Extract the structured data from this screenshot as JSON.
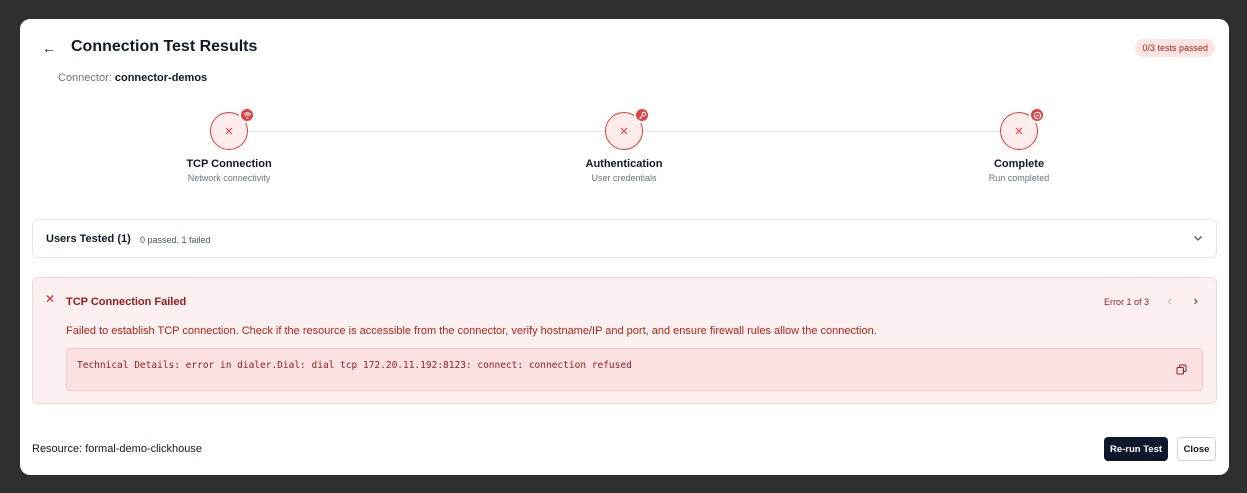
{
  "modal": {
    "title": "Connection Test Results",
    "badge": "0/3 tests passed",
    "connector_label": "Connector:",
    "connector_name": "connector-demos"
  },
  "steps": [
    {
      "label": "TCP Connection",
      "sub": "Network connectivity",
      "status": "failed",
      "icon": "wifi-icon"
    },
    {
      "label": "Authentication",
      "sub": "User credentials",
      "status": "failed",
      "icon": "key-icon"
    },
    {
      "label": "Complete",
      "sub": "Run completed",
      "status": "failed",
      "icon": "check-circle-icon"
    }
  ],
  "users": {
    "title": "Users Tested (1)",
    "summary": "0 passed, 1 failed"
  },
  "error": {
    "title": "TCP Connection Failed",
    "counter": "Error 1 of 3",
    "message": "Failed to establish TCP connection. Check if the resource is accessible from the connector, verify hostname/IP and port, and ensure firewall rules allow the connection.",
    "technical": "Technical Details: error in dialer.Dial: dial tcp 172.20.11.192:8123: connect: connection refused"
  },
  "footer": {
    "resource": "Resource: formal-demo-clickhouse",
    "rerun_label": "Re-run Test",
    "close_label": "Close"
  },
  "colors": {
    "error": "#e53e3e",
    "error_bg": "#fdf0f0",
    "primary": "#0f172a"
  }
}
